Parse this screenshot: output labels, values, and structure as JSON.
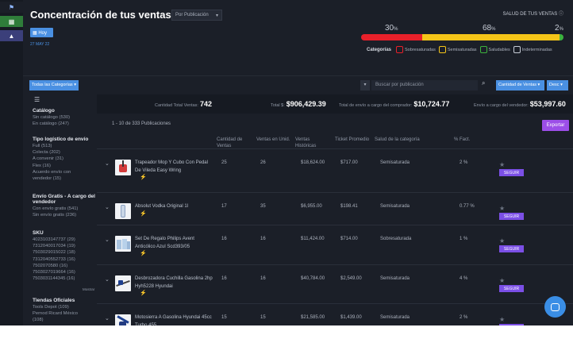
{
  "header": {
    "title": "Concentración de tus ventas",
    "pub_select": "Por Publicación",
    "hoy_label": "Hoy",
    "date": "27 MAY 22",
    "salud_label": "SALUD DE TUS VENTAS",
    "pct_sobre": "30",
    "pct_semi": "68",
    "pct_salud": "2",
    "pct_unit": "%"
  },
  "health": {
    "segments": [
      {
        "name": "Sobresaturadas",
        "value": 30,
        "color": "#e8202a"
      },
      {
        "name": "Semisaturadas",
        "value": 68,
        "color": "#f5c518"
      },
      {
        "name": "Saludables",
        "value": 2,
        "color": "#3db33d"
      }
    ],
    "legend_title": "Categorías",
    "legend": [
      {
        "label": "Sobresaturadas",
        "color": "#e8202a"
      },
      {
        "label": "Semisaturadas",
        "color": "#f5c518"
      },
      {
        "label": "Saludables",
        "color": "#3db33d"
      },
      {
        "label": "Indeterminadas",
        "color": "#c7ccd6"
      }
    ]
  },
  "filters": {
    "categories_button": "Todas las Categorías",
    "search_placeholder": "Buscar por publicación",
    "sort_button": "Cantidad de Ventas",
    "order_button": "Desc"
  },
  "sidebar": {
    "catalogo": {
      "title": "Catálogo",
      "items": [
        "Sin catálogo (530)",
        "En catálogo (247)"
      ]
    },
    "envio": {
      "title": "Tipo logístico de envío",
      "items": [
        "Full (513)",
        "Colecta (202)",
        "A convenir (31)",
        "Flex (16)",
        "Acuerdo envío con",
        "vendedor (15)"
      ]
    },
    "gratis": {
      "title": "Envío Gratis - A cargo del vendedor",
      "items": [
        "Con envío gratis (541)",
        "Sin envío gratis (236)"
      ]
    },
    "sku": {
      "title": "SKU",
      "items": [
        "4023103147737 (29)",
        "7312040017034 (19)",
        "7503029015022 (18)",
        "7312040552733 (16)",
        "7502070580 (16)",
        "7503027019664 (16)",
        "7503031144345 (16)"
      ]
    },
    "mostrar": "Mostrar",
    "tiendas": {
      "title": "Tiendas Oficiales",
      "items": [
        "Tools Depot (109)",
        "Pernod Ricard México",
        "(108)"
      ]
    }
  },
  "totals": {
    "cantidad_label": "Cantidad Total Ventas:",
    "cantidad_value": "742",
    "total_label": "Total $:",
    "total_value": "$906,429.39",
    "envio_comprador_label": "Total de envío a cargo del comprador:",
    "envio_comprador_value": "$10,724.77",
    "envio_vendedor_label": "Envío a cargo del vendedor:",
    "envio_vendedor_value": "$53,997.60"
  },
  "table": {
    "pub_count": "1 - 10 de 333 Publicaciones",
    "export_label": "Exportar",
    "headers": {
      "cantidad": "Cantidad de Ventas",
      "unid": "Ventas en Unid.",
      "historicas": "Ventas Históricas",
      "ticket": "Ticket Promedio",
      "salud": "Salud de la categoría",
      "fact": "% Fact."
    },
    "seguir_label": "SEGUIR",
    "rows": [
      {
        "name": "Trapeador Mop Y Cubo Con Pedal De Vileda Easy Wring",
        "cantidad": "25",
        "unid": "26",
        "historicas": "$18,624.00",
        "ticket": "$717.00",
        "salud": "Semisaturada",
        "fact": "2 %"
      },
      {
        "name": "Absolut Vodka Original 1l",
        "cantidad": "17",
        "unid": "35",
        "historicas": "$6,955.00",
        "ticket": "$198.41",
        "salud": "Semisaturada",
        "fact": "0.77 %"
      },
      {
        "name": "Set De Regalo Philips Avent Anticólico Azul Scd393/05",
        "cantidad": "16",
        "unid": "16",
        "historicas": "$11,424.00",
        "ticket": "$714.00",
        "salud": "Sobresaturada",
        "fact": "1 %"
      },
      {
        "name": "Desbrozadora Cuchilla Gasolina 2hp Hyh5228 Hyundai",
        "cantidad": "16",
        "unid": "16",
        "historicas": "$40,784.00",
        "ticket": "$2,549.00",
        "salud": "Semisaturada",
        "fact": "4 %"
      },
      {
        "name": "Motosierra A Gasolina Hyundai 45cc Turbo 455",
        "cantidad": "15",
        "unid": "15",
        "historicas": "$21,585.00",
        "ticket": "$1,439.00",
        "salud": "Semisaturada",
        "fact": "2 %"
      }
    ]
  }
}
